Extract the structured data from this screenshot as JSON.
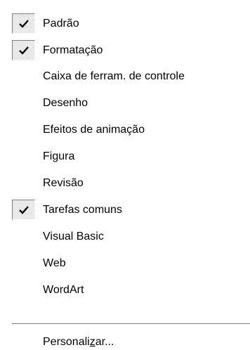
{
  "menu": {
    "items": [
      {
        "label": "Padrão",
        "checked": true
      },
      {
        "label": "Formatação",
        "checked": true
      },
      {
        "label": "Caixa de ferram. de controle",
        "checked": false
      },
      {
        "label": "Desenho",
        "checked": false
      },
      {
        "label": "Efeitos de animação",
        "checked": false
      },
      {
        "label": "Figura",
        "checked": false
      },
      {
        "label": "Revisão",
        "checked": false
      },
      {
        "label": "Tarefas comuns",
        "checked": true
      },
      {
        "label": "Visual Basic",
        "checked": false
      },
      {
        "label": "Web",
        "checked": false
      },
      {
        "label": "WordArt",
        "checked": false
      }
    ],
    "customize": {
      "label_before": "Personali",
      "label_mnemonic": "z",
      "label_after": "ar..."
    }
  }
}
